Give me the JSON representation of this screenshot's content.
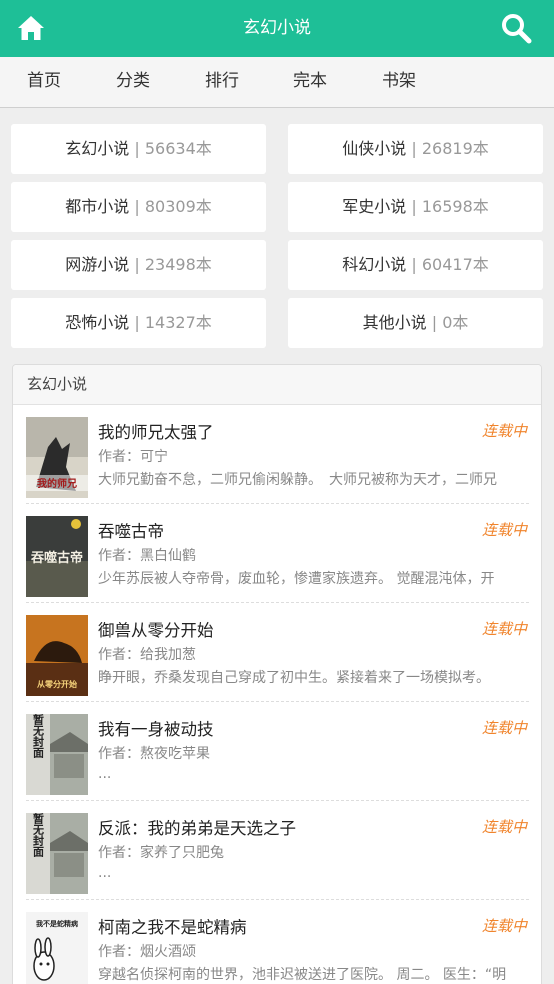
{
  "header": {
    "title": "玄幻小说",
    "home_icon": "home-icon",
    "search_icon": "search-icon",
    "background": "#1ebf97"
  },
  "nav": {
    "items": [
      {
        "label": "首页"
      },
      {
        "label": "分类"
      },
      {
        "label": "排行"
      },
      {
        "label": "完本"
      },
      {
        "label": "书架"
      }
    ]
  },
  "categories": [
    {
      "name": "玄幻小说",
      "sep": "|",
      "count": "56634本"
    },
    {
      "name": "仙侠小说",
      "sep": "|",
      "count": "26819本"
    },
    {
      "name": "都市小说",
      "sep": "|",
      "count": "80309本"
    },
    {
      "name": "军史小说",
      "sep": "|",
      "count": "16598本"
    },
    {
      "name": "网游小说",
      "sep": "|",
      "count": "23498本"
    },
    {
      "name": "科幻小说",
      "sep": "|",
      "count": "60417本"
    },
    {
      "name": "恐怖小说",
      "sep": "|",
      "count": "14327本"
    },
    {
      "name": "其他小说",
      "sep": "|",
      "count": "0本"
    }
  ],
  "section": {
    "title": "玄幻小说",
    "status_color": "#f0842c",
    "books": [
      {
        "title": "我的师兄太强了",
        "status": "连载中",
        "author": "作者：可宁",
        "desc": "大师兄勤奋不怠，二师兄偷闲躲静。　大师兄被称为天才，二师兄",
        "cover_text": "我的师兄"
      },
      {
        "title": "吞噬古帝",
        "status": "连载中",
        "author": "作者：黑白仙鹤",
        "desc": "少年苏辰被人夺帝骨，废血轮，惨遭家族遗弃。 觉醒混沌体，开",
        "cover_text": "吞噬古帝"
      },
      {
        "title": "御兽从零分开始",
        "status": "连载中",
        "author": "作者：给我加葱",
        "desc": "睁开眼，乔桑发现自己穿成了初中生。紧接着来了一场模拟考。",
        "cover_text": "从零分开始"
      },
      {
        "title": "我有一身被动技",
        "status": "连载中",
        "author": "作者：熬夜吃苹果",
        "desc": "...",
        "cover_text": "暂无封面"
      },
      {
        "title": "反派：我的弟弟是天选之子",
        "status": "连载中",
        "author": "作者：家养了只肥兔",
        "desc": "...",
        "cover_text": "暂无封面"
      },
      {
        "title": "柯南之我不是蛇精病",
        "status": "连载中",
        "author": "作者：烟火酒颂",
        "desc": "穿越名侦探柯南的世界，池非迟被送进了医院。 周二。 医生：“明",
        "cover_text": "我不是蛇精病"
      }
    ]
  }
}
